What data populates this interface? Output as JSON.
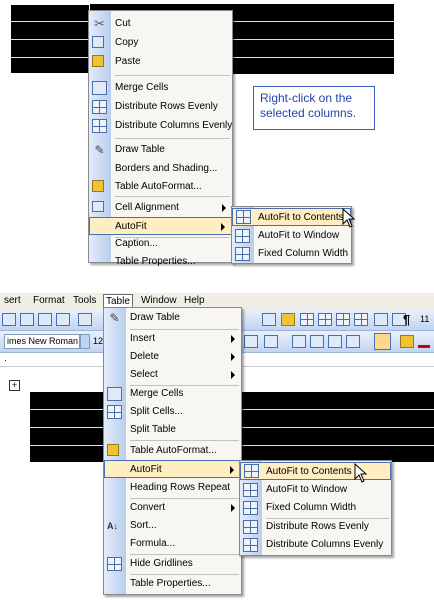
{
  "top_menu": {
    "items": [
      {
        "label": "Cut",
        "icon": "scissors-icon"
      },
      {
        "label": "Copy",
        "icon": "copy-icon"
      },
      {
        "label": "Paste",
        "icon": "paste-icon"
      },
      {
        "label": "Merge Cells",
        "icon": "merge-cells-icon"
      },
      {
        "label": "Distribute Rows Evenly",
        "icon": "distribute-rows-icon"
      },
      {
        "label": "Distribute Columns Evenly",
        "icon": "distribute-columns-icon"
      },
      {
        "label": "Draw Table",
        "icon": "pencil-icon"
      },
      {
        "label": "Borders and Shading...",
        "icon": ""
      },
      {
        "label": "Table AutoFormat...",
        "icon": "table-autoformat-icon"
      },
      {
        "label": "Cell Alignment",
        "icon": "cell-alignment-icon"
      },
      {
        "label": "AutoFit",
        "icon": ""
      },
      {
        "label": "Caption...",
        "icon": ""
      },
      {
        "label": "Table Properties...",
        "icon": ""
      }
    ],
    "submenu": [
      {
        "label": "AutoFit to Contents"
      },
      {
        "label": "AutoFit to Window"
      },
      {
        "label": "Fixed Column Width"
      }
    ]
  },
  "callout": {
    "text": "Right-click on the selected columns."
  },
  "menubar": {
    "items": [
      "sert",
      "Format",
      "Tools",
      "Table",
      "Window",
      "Help"
    ]
  },
  "toolbar": {
    "font_name": "imes New Roman",
    "font_size": "12",
    "zoom_label": "11"
  },
  "bottom_menu": {
    "items": [
      {
        "label": "Draw Table"
      },
      {
        "label": "Insert"
      },
      {
        "label": "Delete"
      },
      {
        "label": "Select"
      },
      {
        "label": "Merge Cells"
      },
      {
        "label": "Split Cells..."
      },
      {
        "label": "Split Table"
      },
      {
        "label": "Table AutoFormat..."
      },
      {
        "label": "AutoFit"
      },
      {
        "label": "Heading Rows Repeat"
      },
      {
        "label": "Convert"
      },
      {
        "label": "Sort..."
      },
      {
        "label": "Formula..."
      },
      {
        "label": "Hide Gridlines"
      },
      {
        "label": "Table Properties..."
      }
    ],
    "submenu": [
      {
        "label": "AutoFit to Contents"
      },
      {
        "label": "AutoFit to Window"
      },
      {
        "label": "Fixed Column Width"
      },
      {
        "label": "Distribute Rows Evenly"
      },
      {
        "label": "Distribute Columns Evenly"
      }
    ]
  },
  "colors": {
    "highlight": "#ffeec2",
    "highlight_border": "#4b6fb0",
    "callout": "#2244aa"
  }
}
